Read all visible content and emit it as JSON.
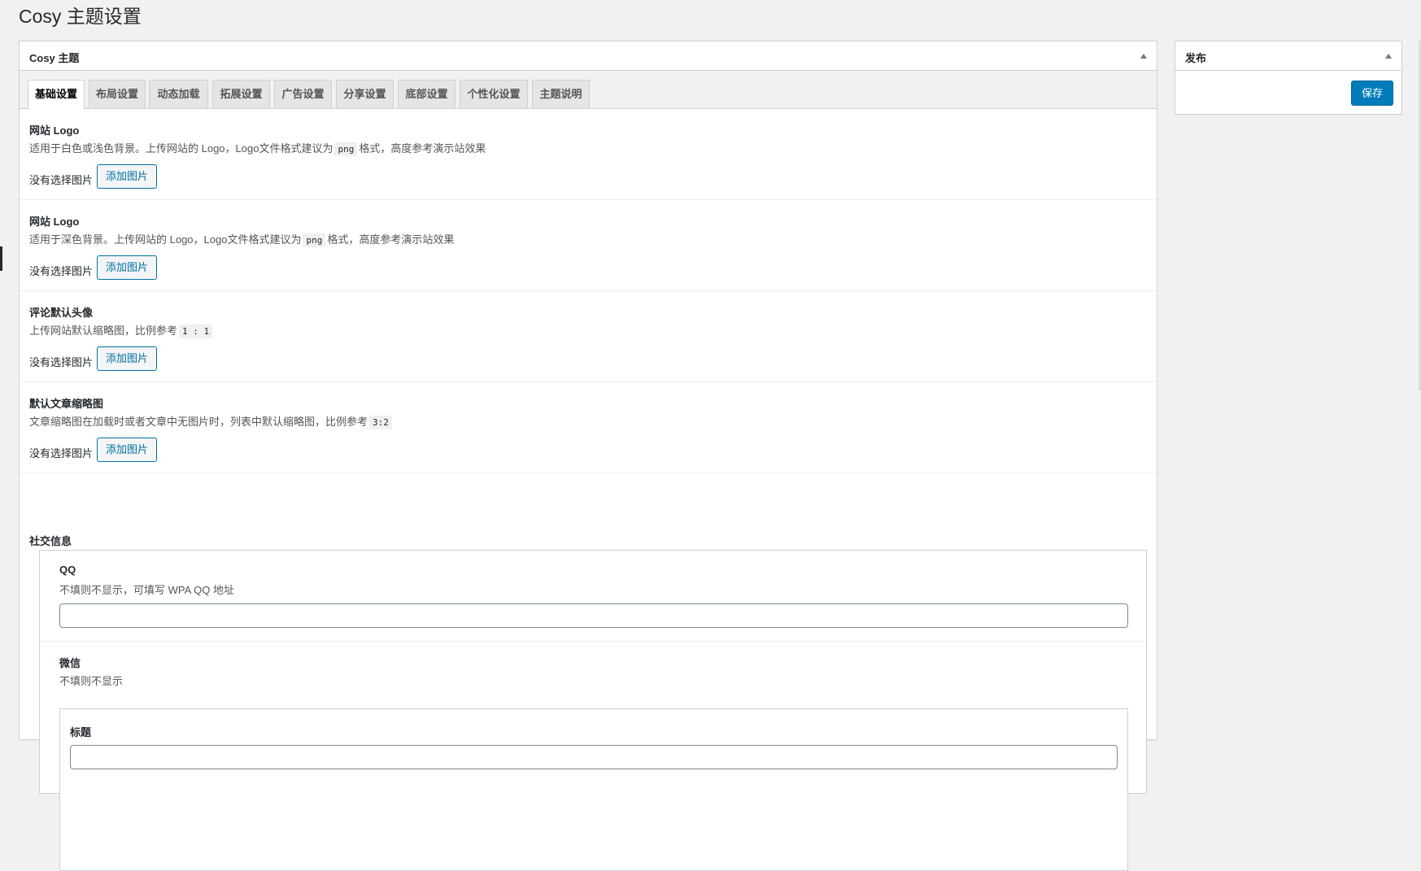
{
  "page": {
    "title": "Cosy 主题设置"
  },
  "main_box": {
    "title": "Cosy 主题",
    "tabs": [
      {
        "label": "基础设置",
        "active": true
      },
      {
        "label": "布局设置",
        "active": false
      },
      {
        "label": "动态加载",
        "active": false
      },
      {
        "label": "拓展设置",
        "active": false
      },
      {
        "label": "广告设置",
        "active": false
      },
      {
        "label": "分享设置",
        "active": false
      },
      {
        "label": "底部设置",
        "active": false
      },
      {
        "label": "个性化设置",
        "active": false
      },
      {
        "label": "主题说明",
        "active": false
      }
    ],
    "fields": [
      {
        "title": "网站 Logo",
        "desc_before": "适用于白色或浅色背景。上传网站的 Logo，Logo文件格式建议为",
        "code": "png",
        "desc_after": "格式，高度参考演示站效果",
        "no_image_label": "没有选择图片",
        "button_label": "添加图片"
      },
      {
        "title": "网站 Logo",
        "desc_before": "适用于深色背景。上传网站的 Logo，Logo文件格式建议为",
        "code": "png",
        "desc_after": "格式，高度参考演示站效果",
        "no_image_label": "没有选择图片",
        "button_label": "添加图片"
      },
      {
        "title": "评论默认头像",
        "desc_before": "上传网站默认缩略图，比例参考",
        "code": "1 : 1",
        "desc_after": "",
        "no_image_label": "没有选择图片",
        "button_label": "添加图片"
      },
      {
        "title": "默认文章缩略图",
        "desc_before": "文章缩略图在加载时或者文章中无图片时，列表中默认缩略图，比例参考",
        "code": "3:2",
        "desc_after": "",
        "no_image_label": "没有选择图片",
        "button_label": "添加图片"
      }
    ],
    "social": {
      "title": "社交信息",
      "qq": {
        "title": "QQ",
        "desc": "不填则不显示，可填写 WPA QQ 地址",
        "value": ""
      },
      "wechat": {
        "title": "微信",
        "desc": "不填则不显示",
        "inner_title": "标题",
        "inner_value": ""
      }
    }
  },
  "publish_box": {
    "title": "发布",
    "save_label": "保存",
    "accent_color": "#007cba"
  }
}
